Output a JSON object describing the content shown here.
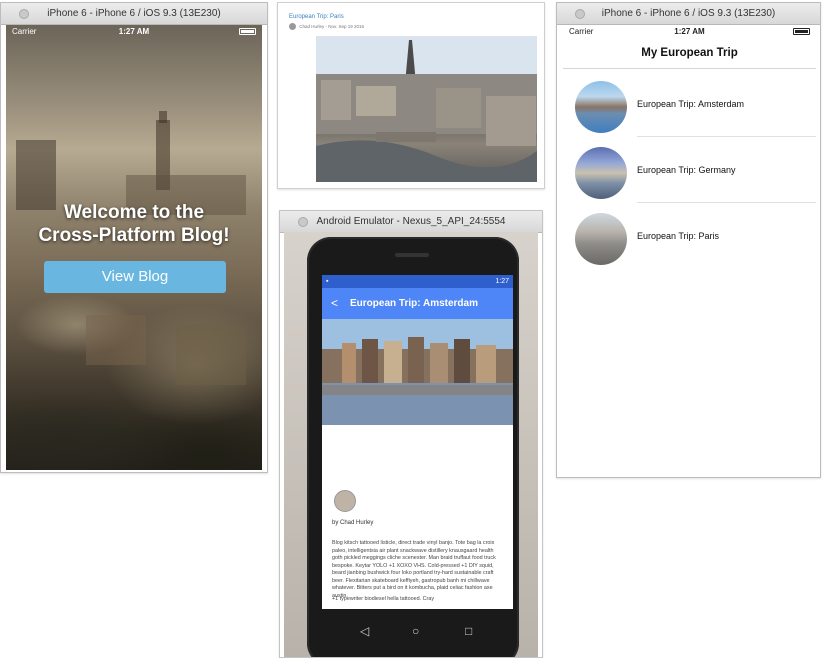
{
  "panel1": {
    "window_title": "iPhone 6 - iPhone 6 / iOS 9.3 (13E230)",
    "carrier": "Carrier",
    "time": "1:27 AM",
    "welcome_line1": "Welcome to the",
    "welcome_line2": "Cross-Platform Blog!",
    "button_label": "View Blog"
  },
  "panel2": {
    "post_title": "European Trip: Paris",
    "author_meta": "Chad Hurley - Nov. Sep 19 2016"
  },
  "panel3": {
    "window_title": "Android Emulator - Nexus_5_API_24:5554",
    "status_time": "1:27",
    "appbar_title": "European Trip: Amsterdam",
    "back_glyph": "<",
    "byline": "by Chad Hurley",
    "body": "Blog kitsch tattooed listicle, direct trade vinyl banjo. Tote bag la croix paleo, intelligentsia air plant snackwave distillery knausgaard health goth pickled meggings cliche scenester. Man braid truffaut food truck bespoke. Keytar YOLO +1 XOXO VHS. Cold-pressed +1 DIY squid, beard jianbing bushwick four loko portland try-hard sustainable craft beer. Flexitarian skateboard keffiyeh, gastropub banh mi chillwave whatever. Bitters put a bird on it kombucha, plaid celiac fashion axe austin.",
    "body_more": "+1 typewriter biodiesel hella tattooed. Cray",
    "nav_back": "◁",
    "nav_home": "○",
    "nav_recent": "□"
  },
  "panel4": {
    "window_title": "iPhone 6 - iPhone 6 / iOS 9.3 (13E230)",
    "carrier": "Carrier",
    "time": "1:27 AM",
    "nav_title": "My European Trip",
    "items": [
      {
        "label": "European Trip: Amsterdam"
      },
      {
        "label": "European Trip: Germany"
      },
      {
        "label": "European Trip: Paris"
      }
    ]
  }
}
